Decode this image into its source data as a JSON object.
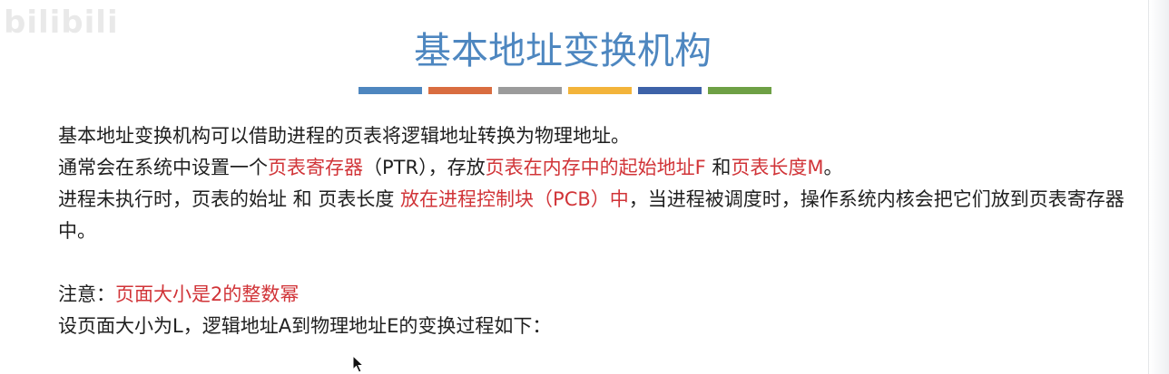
{
  "watermark": "bilibili",
  "slide": {
    "title": "基本地址变换机构",
    "divider_colors": [
      "#4e86bf",
      "#d96d40",
      "#9b9b9b",
      "#f3b43a",
      "#3d62a8",
      "#6ea045"
    ]
  },
  "body": {
    "line1": "基本地址变换机构可以借助进程的页表将逻辑地址转换为物理地址。",
    "line2": {
      "t1": "通常会在系统中设置一个",
      "t2": "页表寄存器",
      "t3": "（PTR），存放",
      "t4": "页表在内存中的起始地址F",
      "t5": " 和",
      "t6": "页表长度M",
      "t7": "。"
    },
    "line3": {
      "t1": "进程未执行时，页表的始址 和 页表长度 ",
      "t2": "放在进程控制块（PCB）中",
      "t3": "，当进程被调度时，操作系统内核会把它们放到页表寄存器中。"
    },
    "line4": {
      "t1": "注意：",
      "t2": "页面大小是2的整数幂"
    },
    "line5": "设页面大小为L，逻辑地址A到物理地址E的变换过程如下："
  },
  "icons": {
    "cursor": "mouse-pointer-icon"
  }
}
